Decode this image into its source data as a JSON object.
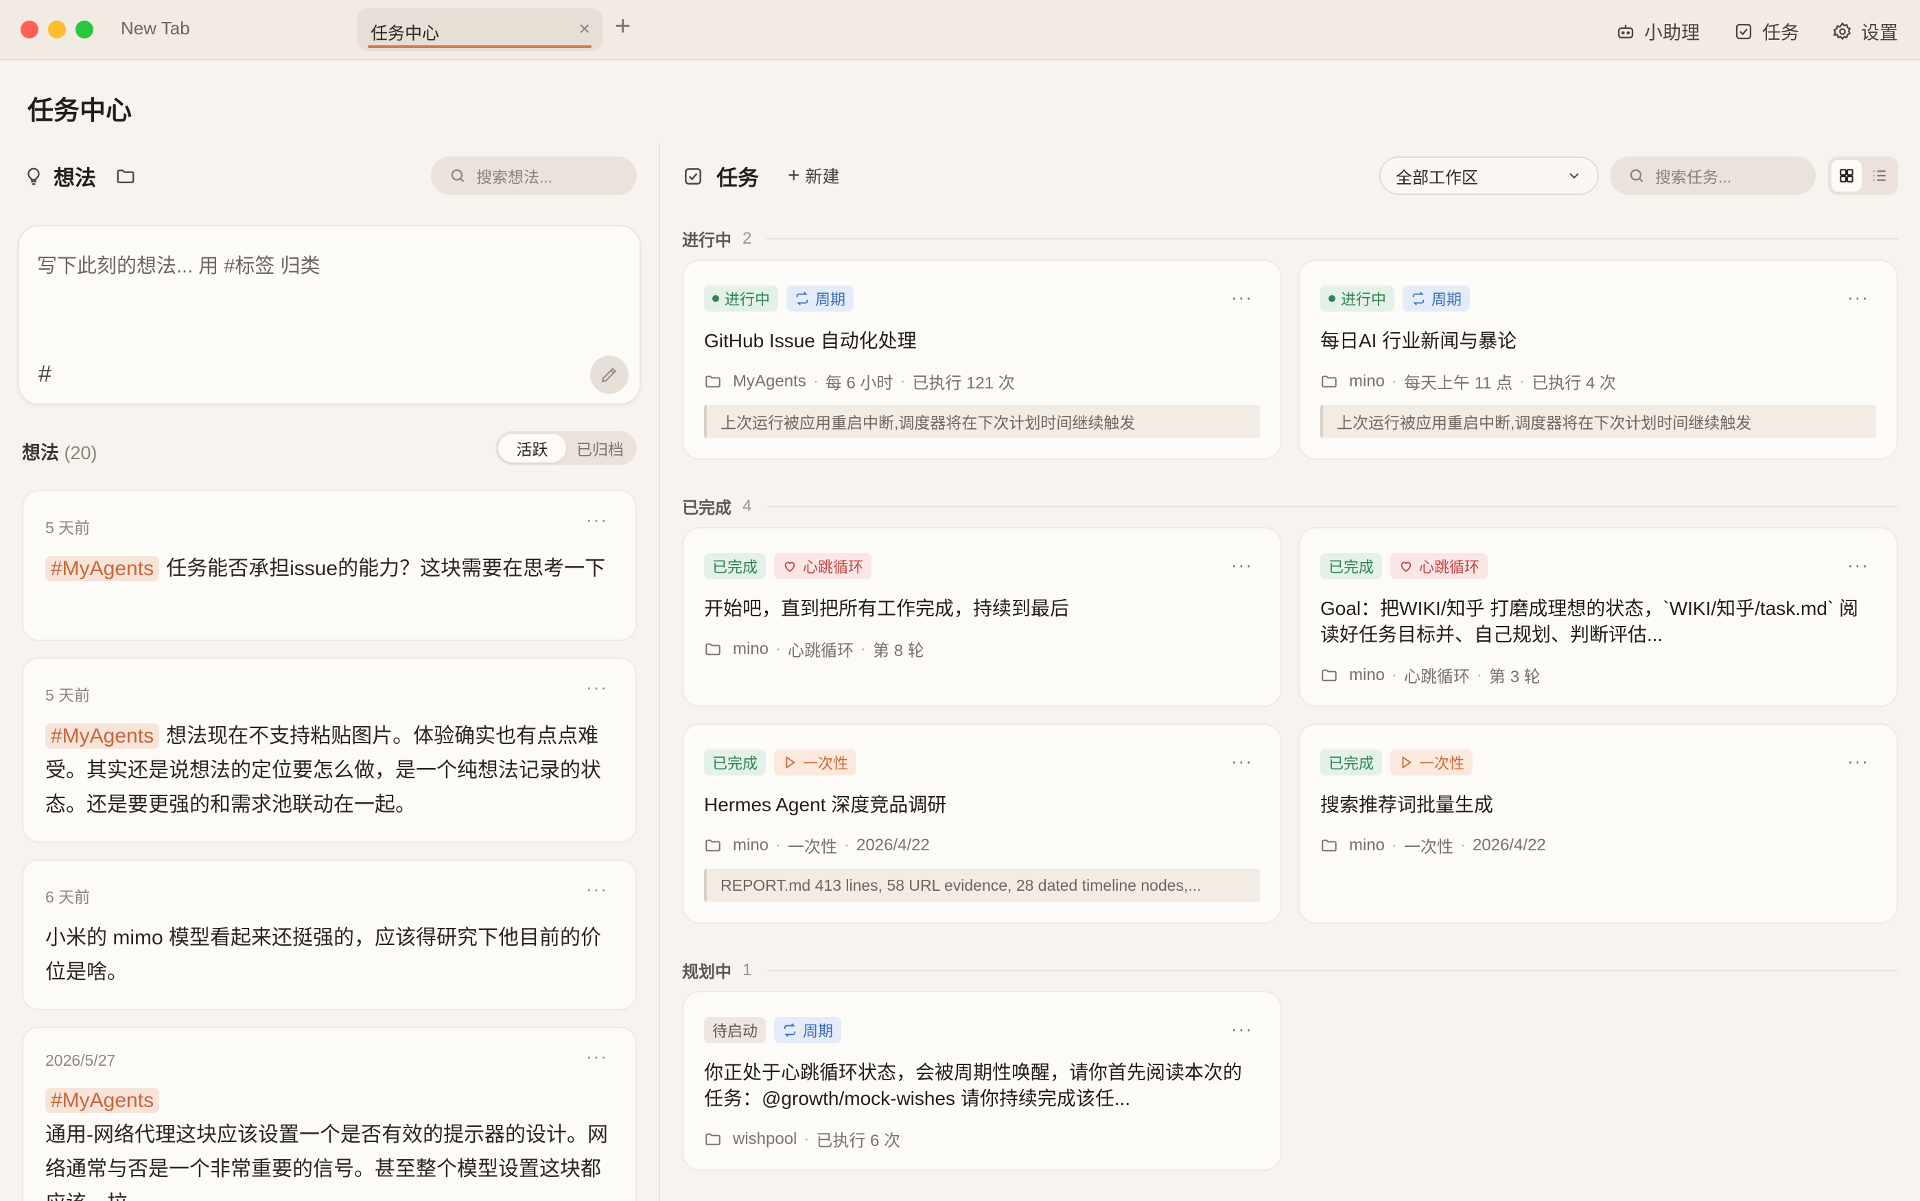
{
  "tabs": {
    "plain": "New Tab",
    "active": "任务中心",
    "close": "×",
    "add": "+"
  },
  "toolbar": {
    "assistant": "小助理",
    "tasks": "任务",
    "settings": "设置"
  },
  "page": {
    "title": "任务中心"
  },
  "ideas": {
    "title": "想法",
    "search_placeholder": "搜索想法...",
    "composer_placeholder": "写下此刻的想法... 用 #标签 归类",
    "composer_hash": "#",
    "count_label": "想法",
    "count": "(20)",
    "seg_active": "活跃",
    "seg_archived": "已归档",
    "more": "···",
    "items": [
      {
        "time": "5 天前",
        "tag": "#MyAgents",
        "text": "任务能否承担issue的能力？这块需要在思考一下"
      },
      {
        "time": "5 天前",
        "tag": "#MyAgents",
        "text": "想法现在不支持粘贴图片。体验确实也有点点难受。其实还是说想法的定位要怎么做，是一个纯想法记录的状态。还是要更强的和需求池联动在一起。"
      },
      {
        "time": "6 天前",
        "tag": "",
        "text": "小米的 mimo 模型看起来还挺强的，应该得研究下他目前的价位是啥。"
      },
      {
        "time": "2026/5/27",
        "tag": "#MyAgents",
        "text": "通用-网络代理这块应该设置一个是否有效的提示器的设计。网络通常与否是一个非常重要的信号。甚至整个模型设置这块都应该一拉"
      }
    ]
  },
  "tasks": {
    "title": "任务",
    "new_label": "新建",
    "workspace": "全部工作区",
    "search_placeholder": "搜索任务...",
    "more": "···",
    "sections": [
      {
        "name": "进行中",
        "count": "2"
      },
      {
        "name": "已完成",
        "count": "4"
      },
      {
        "name": "规划中",
        "count": "1"
      }
    ],
    "cards": [
      {
        "status": "进行中",
        "kind": "周期",
        "title": "GitHub Issue 自动化处理",
        "workspace": "MyAgents",
        "m1": "每 6 小时",
        "m2": "已执行 121 次",
        "note": "上次运行被应用重启中断,调度器将在下次计划时间继续触发"
      },
      {
        "status": "进行中",
        "kind": "周期",
        "title": "每日AI 行业新闻与暴论",
        "workspace": "mino",
        "m1": "每天上午 11 点",
        "m2": "已执行 4 次",
        "note": "上次运行被应用重启中断,调度器将在下次计划时间继续触发"
      },
      {
        "status": "已完成",
        "kind": "心跳循环",
        "title": "开始吧，直到把所有工作完成，持续到最后",
        "workspace": "mino",
        "m1": "心跳循环",
        "m2": "第 8 轮",
        "note": ""
      },
      {
        "status": "已完成",
        "kind": "心跳循环",
        "title": "Goal：把WIKI/知乎 打磨成理想的状态，`WIKI/知乎/task.md` 阅读好任务目标并、自己规划、判断评估...",
        "workspace": "mino",
        "m1": "心跳循环",
        "m2": "第 3 轮",
        "note": ""
      },
      {
        "status": "已完成",
        "kind": "一次性",
        "title": "Hermes Agent 深度竞品调研",
        "workspace": "mino",
        "m1": "一次性",
        "m2": "2026/4/22",
        "note": "REPORT.md 413 lines, 58 URL evidence, 28 dated timeline nodes,..."
      },
      {
        "status": "已完成",
        "kind": "一次性",
        "title": "搜索推荐词批量生成",
        "workspace": "mino",
        "m1": "一次性",
        "m2": "2026/4/22",
        "note": ""
      },
      {
        "status": "待启动",
        "kind": "周期",
        "title": "你正处于心跳循环状态，会被周期性唤醒，请你首先阅读本次的任务：@growth/mock-wishes 请你持续完成该任...",
        "workspace": "wishpool",
        "m1": "已执行 6 次",
        "m2": "",
        "note": ""
      }
    ]
  },
  "colors": {
    "accent": "#d97a4e",
    "running": "#2f8350",
    "cycle": "#3a6fb5",
    "heartbeat": "#c74545",
    "oneoff": "#cc6a33"
  }
}
